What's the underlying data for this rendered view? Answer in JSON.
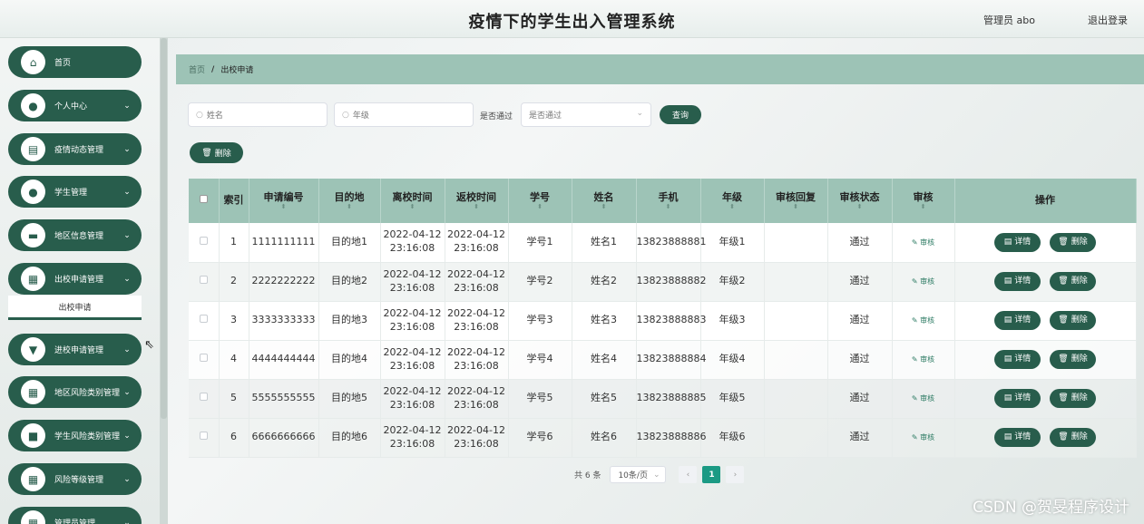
{
  "header": {
    "title": "疫情下的学生出入管理系统",
    "user": "管理员 abo",
    "logout": "退出登录"
  },
  "sidebar": {
    "items": [
      {
        "label": "首页",
        "icon": "home-icon",
        "glyph": "⌂",
        "chev": ""
      },
      {
        "label": "个人中心",
        "icon": "user-icon",
        "glyph": "●",
        "chev": "⌄"
      },
      {
        "label": "疫情动态管理",
        "icon": "document-icon",
        "glyph": "▤",
        "chev": "⌄"
      },
      {
        "label": "学生管理",
        "icon": "student-icon",
        "glyph": "●",
        "chev": "⌄"
      },
      {
        "label": "地区信息管理",
        "icon": "briefcase-icon",
        "glyph": "▬",
        "chev": "⌄"
      },
      {
        "label": "出校申请管理",
        "icon": "grid-icon",
        "glyph": "▦",
        "chev": "⌄"
      },
      {
        "label": "进校申请管理",
        "icon": "shield-icon",
        "glyph": "▼",
        "chev": "⌄"
      },
      {
        "label": "地区风险类别管理",
        "icon": "grid-icon",
        "glyph": "▦",
        "chev": "⌄"
      },
      {
        "label": "学生风险类别管理",
        "icon": "chat-icon",
        "glyph": "■",
        "chev": "⌄"
      },
      {
        "label": "风险等级管理",
        "icon": "grid-icon",
        "glyph": "▦",
        "chev": "⌄"
      },
      {
        "label": "管理员管理",
        "icon": "grid-icon",
        "glyph": "▦",
        "chev": "⌄"
      }
    ],
    "sub_item": "出校申请"
  },
  "breadcrumb": {
    "home": "首页",
    "sep": "/",
    "current": "出校申请"
  },
  "filters": {
    "name_placeholder": "姓名",
    "grade_placeholder": "年级",
    "pass_label": "是否通过",
    "pass_placeholder": "是否通过",
    "search_btn": "查询",
    "delete_btn": "删除"
  },
  "table": {
    "headers": [
      "索引",
      "申请编号",
      "目的地",
      "离校时间",
      "返校时间",
      "学号",
      "姓名",
      "手机",
      "年级",
      "审核回复",
      "审核状态",
      "审核",
      "操作"
    ],
    "audit_link": "审核",
    "detail_btn": "详情",
    "delete_btn": "删除",
    "rows": [
      {
        "idx": "1",
        "no": "1111111111",
        "dest": "目的地1",
        "leave": "2022-04-12 23:16:08",
        "ret": "2022-04-12 23:16:08",
        "sid": "学号1",
        "name": "姓名1",
        "phone": "13823888881",
        "grade": "年级1",
        "reply": "",
        "status": "通过"
      },
      {
        "idx": "2",
        "no": "2222222222",
        "dest": "目的地2",
        "leave": "2022-04-12 23:16:08",
        "ret": "2022-04-12 23:16:08",
        "sid": "学号2",
        "name": "姓名2",
        "phone": "13823888882",
        "grade": "年级2",
        "reply": "",
        "status": "通过"
      },
      {
        "idx": "3",
        "no": "3333333333",
        "dest": "目的地3",
        "leave": "2022-04-12 23:16:08",
        "ret": "2022-04-12 23:16:08",
        "sid": "学号3",
        "name": "姓名3",
        "phone": "13823888883",
        "grade": "年级3",
        "reply": "",
        "status": "通过"
      },
      {
        "idx": "4",
        "no": "4444444444",
        "dest": "目的地4",
        "leave": "2022-04-12 23:16:08",
        "ret": "2022-04-12 23:16:08",
        "sid": "学号4",
        "name": "姓名4",
        "phone": "13823888884",
        "grade": "年级4",
        "reply": "",
        "status": "通过"
      },
      {
        "idx": "5",
        "no": "5555555555",
        "dest": "目的地5",
        "leave": "2022-04-12 23:16:08",
        "ret": "2022-04-12 23:16:08",
        "sid": "学号5",
        "name": "姓名5",
        "phone": "13823888885",
        "grade": "年级5",
        "reply": "",
        "status": "通过"
      },
      {
        "idx": "6",
        "no": "6666666666",
        "dest": "目的地6",
        "leave": "2022-04-12 23:16:08",
        "ret": "2022-04-12 23:16:08",
        "sid": "学号6",
        "name": "姓名6",
        "phone": "13823888886",
        "grade": "年级6",
        "reply": "",
        "status": "通过"
      }
    ]
  },
  "pager": {
    "total": "共 6 条",
    "page_size": "10条/页",
    "current_page": "1"
  },
  "watermark": "CSDN @贺旻程序设计"
}
